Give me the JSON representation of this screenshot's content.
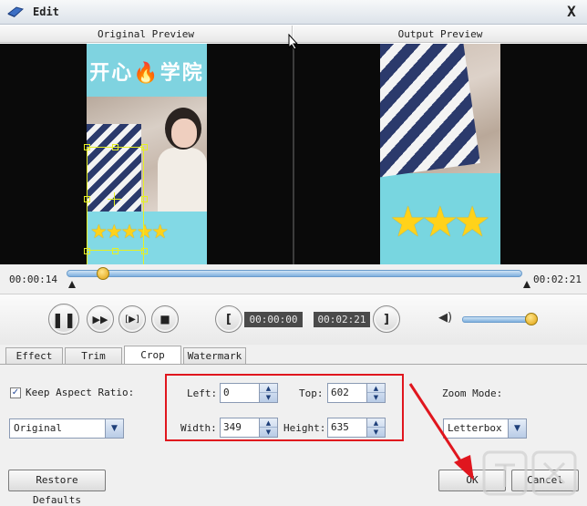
{
  "window": {
    "title": "Edit",
    "close_glyph": "X"
  },
  "preview": {
    "original_label": "Original Preview",
    "output_label": "Output Preview",
    "frame_logo": "开心🔥学院",
    "stars_small": "★★★★★",
    "stars_large": "★★★"
  },
  "seek": {
    "current_time": "00:00:14",
    "total_time": "00:02:21",
    "position_fraction": 0.08
  },
  "playback": {
    "pause_glyph": "❚❚",
    "ff_glyph": "▶▶",
    "step_glyph": "[▶]",
    "stop_glyph": "■",
    "markin_glyph": "[",
    "markout_glyph": "]",
    "start_time": "00:00:00",
    "end_time": "00:02:21",
    "volume_glyph": "◀)",
    "volume_fraction": 0.95
  },
  "tabs": [
    {
      "label": "Effect"
    },
    {
      "label": "Trim"
    },
    {
      "label": "Crop",
      "active": true
    },
    {
      "label": "Watermark"
    }
  ],
  "crop": {
    "keep_aspect_label": "Keep Aspect Ratio:",
    "keep_aspect_checked": true,
    "check_glyph": "✓",
    "aspect_value": "Original",
    "left_label": "Left:",
    "left_value": "0",
    "top_label": "Top:",
    "top_value": "602",
    "width_label": "Width:",
    "width_value": "349",
    "height_label": "Height:",
    "height_value": "635",
    "zoom_label": "Zoom Mode:",
    "zoom_value": "Letterbox",
    "spin_up_glyph": "▲",
    "spin_down_glyph": "▼",
    "combo_glyph": "▼"
  },
  "buttons": {
    "restore": "Restore Defaults",
    "ok": "OK",
    "cancel": "Cancel"
  },
  "colors": {
    "annotation_red": "#e0161e",
    "crop_handle": "#e6f024",
    "accent_blue": "#7fb0de"
  }
}
